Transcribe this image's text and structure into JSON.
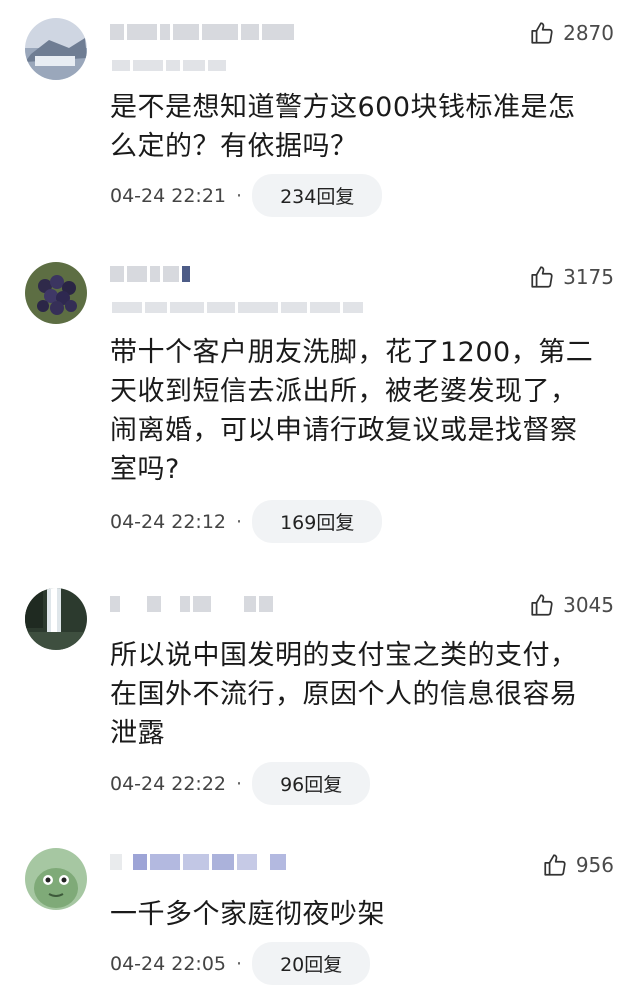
{
  "comments": [
    {
      "likes": "2870",
      "text_lines": [
        "是不是想知道警方这600块钱标准是怎",
        "么定的？有依据吗？"
      ],
      "time": "04-24 22:21",
      "replies": "234回复"
    },
    {
      "likes": "3175",
      "text_lines": [
        "带十个客户朋友洗脚，花了1200，第二",
        "天收到短信去派出所，被老婆发现了，",
        "闹离婚，可以申请行政复议或是找督察",
        "室吗?"
      ],
      "time": "04-24 22:12",
      "replies": "169回复"
    },
    {
      "likes": "3045",
      "text_lines": [
        "所以说中国发明的支付宝之类的支付，",
        "在国外不流行，原因个人的信息很容易",
        "泄露"
      ],
      "time": "04-24 22:22",
      "replies": "96回复"
    },
    {
      "likes": "956",
      "text_lines": [
        "一千多个家庭彻夜吵架"
      ],
      "time": "04-24 22:05",
      "replies": "20回复"
    }
  ],
  "icons": {
    "like": "thumbs-up-icon"
  },
  "colors": {
    "reply_pill_bg": "#f1f3f5",
    "meta_text": "#444444"
  }
}
